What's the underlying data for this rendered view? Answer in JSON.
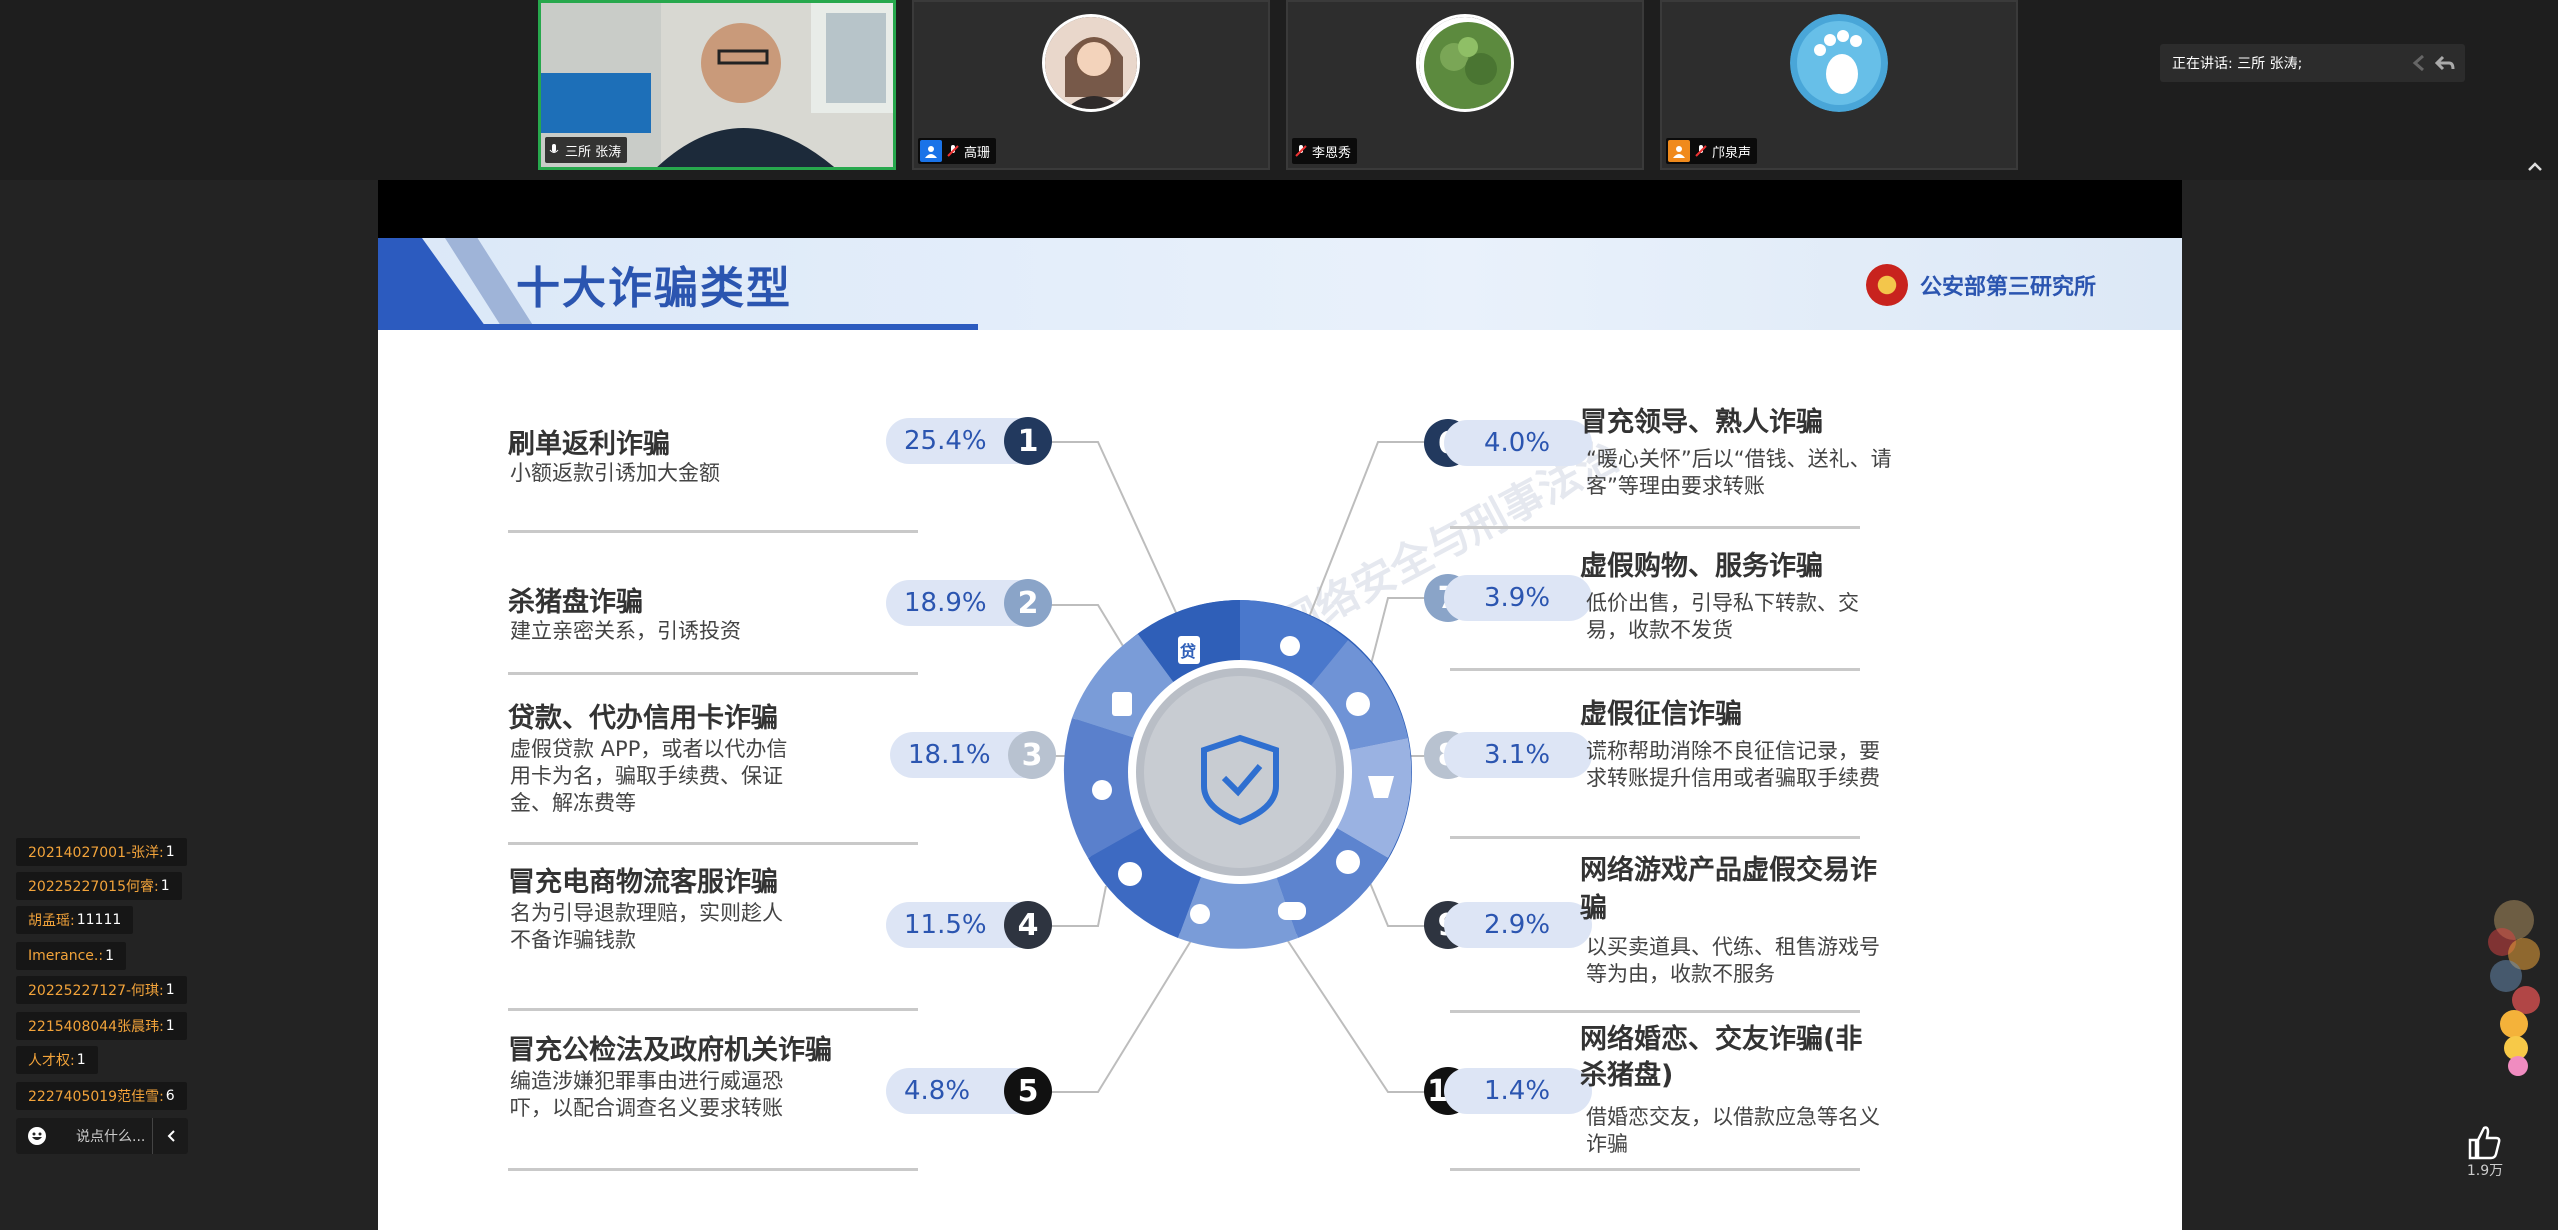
{
  "participants": [
    {
      "name": "三所 张涛",
      "active": true
    },
    {
      "name": "高珊",
      "active": false
    },
    {
      "name": "李恩秀",
      "active": false
    },
    {
      "name": "邝泉声",
      "active": false
    }
  ],
  "speaking_label": "正在讲话: 三所 张涛;",
  "slide": {
    "title": "十大诈骗类型",
    "org": "公安部第三研究所",
    "watermark": "网络安全与刑事法治",
    "left_items": [
      {
        "num": "1",
        "pct": "25.4%",
        "title": "刷单返利诈骗",
        "desc": "小额返款引诱加大金额"
      },
      {
        "num": "2",
        "pct": "18.9%",
        "title": "杀猪盘诈骗",
        "desc": "建立亲密关系，引诱投资"
      },
      {
        "num": "3",
        "pct": "18.1%",
        "title": "贷款、代办信用卡诈骗",
        "desc": "虚假贷款 APP，或者以代办信用卡为名，骗取手续费、保证金、解冻费等"
      },
      {
        "num": "4",
        "pct": "11.5%",
        "title": "冒充电商物流客服诈骗",
        "desc": "名为引导退款理赔，实则趁人不备诈骗钱款"
      },
      {
        "num": "5",
        "pct": "4.8%",
        "title": "冒充公检法及政府机关诈骗",
        "desc": "编造涉嫌犯罪事由进行威逼恐吓，以配合调查名义要求转账"
      }
    ],
    "right_items": [
      {
        "num": "6",
        "pct": "4.0%",
        "title": "冒充领导、熟人诈骗",
        "desc": "“暖心关怀”后以“借钱、送礼、请客”等理由要求转账"
      },
      {
        "num": "7",
        "pct": "3.9%",
        "title": "虚假购物、服务诈骗",
        "desc": "低价出售，引导私下转款、交易，收款不发货"
      },
      {
        "num": "8",
        "pct": "3.1%",
        "title": "虚假征信诈骗",
        "desc": "谎称帮助消除不良征信记录，要求转账提升信用或者骗取手续费"
      },
      {
        "num": "9",
        "pct": "2.9%",
        "title": "网络游戏产品虚假交易诈骗",
        "desc": "以买卖道具、代练、租售游戏号等为由，收款不服务"
      },
      {
        "num": "10",
        "pct": "1.4%",
        "title": "网络婚恋、交友诈骗(非杀猪盘)",
        "desc": "借婚恋交友，以借款应急等名义诈骗"
      }
    ],
    "center_icons": [
      "贷"
    ]
  },
  "chat": [
    {
      "user": "20214027001-张洋:",
      "text": "1"
    },
    {
      "user": "20225227015何睿:",
      "text": "1"
    },
    {
      "user": "胡孟瑶:",
      "text": "11111"
    },
    {
      "user": "Imerance.:",
      "text": "1"
    },
    {
      "user": "20225227127-何琪:",
      "text": "1"
    },
    {
      "user": "2215408044张晨玮:",
      "text": "1"
    },
    {
      "user": "人才权:",
      "text": "1"
    },
    {
      "user": "2227405019范佳雪:",
      "text": "6"
    }
  ],
  "chat_input_placeholder": "说点什么...",
  "like_count": "1.9万",
  "colors": {
    "accent": "#2b55b0",
    "active_border": "#27a84d",
    "chat_user": "#f2a33a"
  }
}
